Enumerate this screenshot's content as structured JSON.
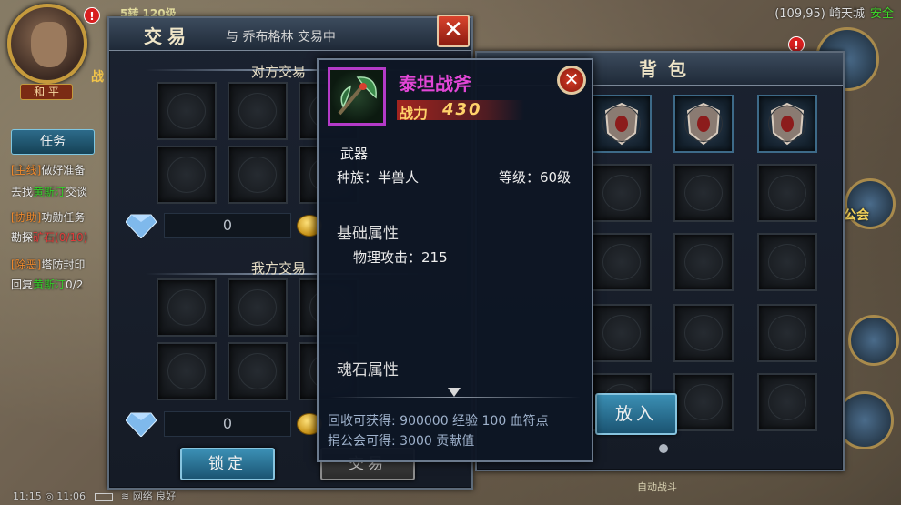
{
  "hud": {
    "level_text": "5转 120级",
    "peace_label": "和 平",
    "hero_side_label": "战",
    "location": "(109,95) 崎天城",
    "safe_label": "安全",
    "guild_label": "公会",
    "auto_battle_label": "自动战斗",
    "alert_mark": "!"
  },
  "quest": {
    "tab_label": "任务",
    "lines": [
      {
        "tag": "[主线]",
        "text": "做好准备"
      },
      {
        "pre": "去找",
        "name": "黄斯汀",
        "text": "交谈"
      },
      {
        "tag": "[协助]",
        "text": "功勋任务"
      },
      {
        "pre": "勘探",
        "name": "矿石(0/10)"
      },
      {
        "tag": "[除恶]",
        "text": "塔防封印"
      },
      {
        "pre": "回复",
        "name": "黄斯汀",
        "text": "0/2"
      }
    ]
  },
  "status_bar": {
    "time_text": "11:15 ◎ 11:06",
    "network_text": "网络 良好"
  },
  "trade": {
    "title": "交易",
    "subtitle": "与 乔布格林 交易中",
    "close_icon": "close-icon",
    "other_section_title": "对方交易",
    "my_section_title": "我方交易",
    "other_gem_amount": "0",
    "my_gem_amount": "0",
    "lock_button": "锁定",
    "trade_button": "交易"
  },
  "bag": {
    "title": "背包",
    "put_in_button": "放入"
  },
  "tooltip": {
    "item_name": "泰坦战斧",
    "power_label": "战力",
    "power_value": "430",
    "item_type": "武器",
    "race_label": "种族：半兽人",
    "level_label": "等级：60级",
    "basic_attrs_heading": "基础属性",
    "physical_attack": "物理攻击：215",
    "soulstone_heading": "魂石属性",
    "recycle_text": "回收可获得: 900000 经验 100 血符点",
    "donate_text": "捐公会可得: 3000 贡献值",
    "close_icon": "close-icon"
  },
  "colors": {
    "item_name": "#e246d6",
    "power": "#ffd26a",
    "safe": "#3ede2a",
    "button_blue": "#1b5472"
  }
}
